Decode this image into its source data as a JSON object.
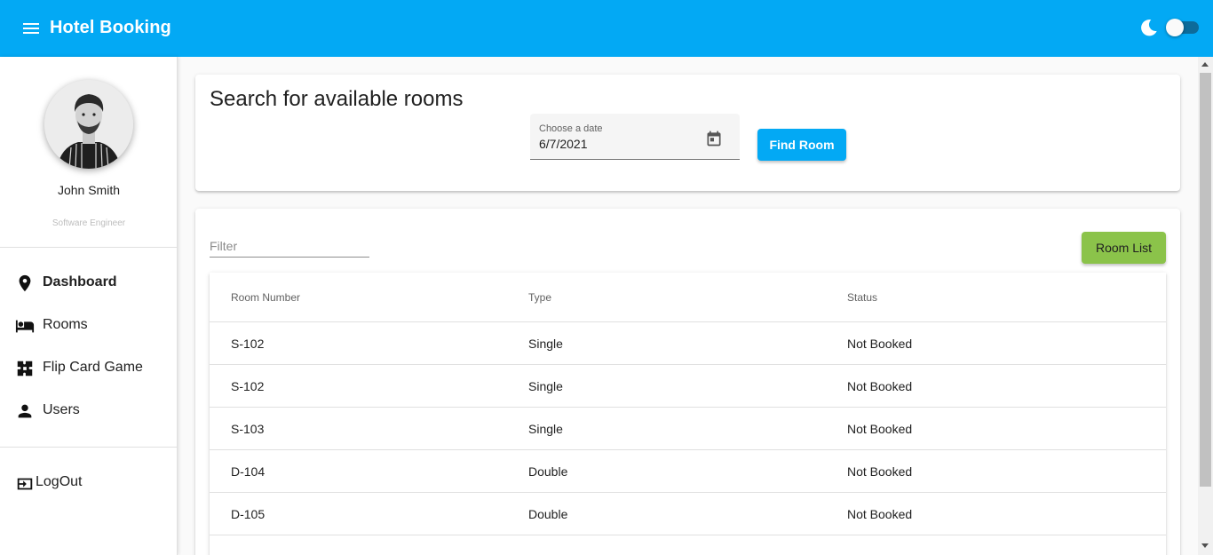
{
  "header": {
    "title": "Hotel Booking",
    "menu_icon": "menu-icon",
    "theme_icon": "moon-icon",
    "accent_color": "#03a9f4",
    "dark_mode_toggle": "off"
  },
  "sidebar": {
    "user": {
      "name": "John Smith",
      "role": "Software Engineer"
    },
    "nav": [
      {
        "label": "Dashboard",
        "icon": "location-pin-icon",
        "active": true
      },
      {
        "label": "Rooms",
        "icon": "bed-icon"
      },
      {
        "label": "Flip Card Game",
        "icon": "puzzle-icon"
      },
      {
        "label": "Users",
        "icon": "person-icon"
      }
    ],
    "logout": {
      "label": "LogOut",
      "icon": "logout-icon"
    }
  },
  "search": {
    "title": "Search for available rooms",
    "date_label": "Choose a date",
    "date_value": "6/7/2021",
    "calendar_icon": "calendar-icon",
    "find_button": "Find Room"
  },
  "rooms": {
    "filter_placeholder": "Filter",
    "room_list_button": "Room List",
    "room_list_color": "#8bc34a",
    "columns": [
      "Room Number",
      "Type",
      "Status"
    ],
    "rows": [
      [
        "S-102",
        "Single",
        "Not Booked"
      ],
      [
        "S-102",
        "Single",
        "Not Booked"
      ],
      [
        "S-103",
        "Single",
        "Not Booked"
      ],
      [
        "D-104",
        "Double",
        "Not Booked"
      ],
      [
        "D-105",
        "Double",
        "Not Booked"
      ]
    ]
  }
}
